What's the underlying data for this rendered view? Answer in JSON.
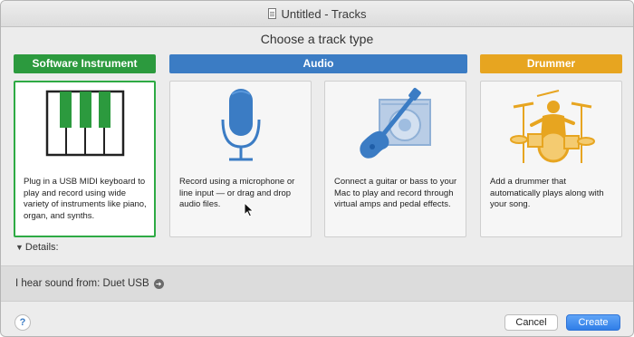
{
  "window": {
    "title": "Untitled - Tracks"
  },
  "header": {
    "title": "Choose a track type"
  },
  "groups": [
    {
      "label": "Software Instrument",
      "color": "#2c9a3e"
    },
    {
      "label": "Audio",
      "color": "#3b7cc4"
    },
    {
      "label": "Drummer",
      "color": "#e7a520"
    }
  ],
  "cards": [
    {
      "icon": "piano-keyboard-icon",
      "description": "Plug in a USB MIDI keyboard to play and record using wide variety of instruments like piano, organ, and synths.",
      "selected": true
    },
    {
      "icon": "microphone-icon",
      "description": "Record using a microphone or line input — or drag and drop audio files.",
      "selected": false
    },
    {
      "icon": "guitar-amp-icon",
      "description": "Connect a guitar or bass to your Mac to play and record through virtual amps and pedal effects.",
      "selected": false
    },
    {
      "icon": "drummer-icon",
      "description": "Add a drummer that automatically plays along with your song.",
      "selected": false
    }
  ],
  "details": {
    "label": "Details:"
  },
  "sound": {
    "label": "I hear sound from: Duet USB"
  },
  "footer": {
    "help": "?",
    "cancel": "Cancel",
    "create": "Create"
  },
  "colors": {
    "accent_green": "#2eaa44",
    "accent_blue": "#3b7cc4",
    "accent_gold": "#e7a520"
  }
}
